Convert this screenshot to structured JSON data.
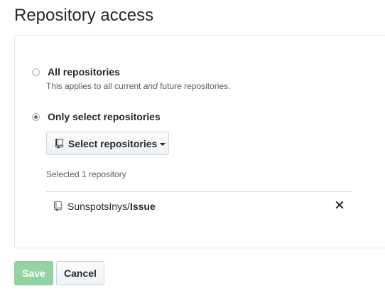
{
  "page": {
    "title": "Repository access"
  },
  "access": {
    "options": [
      {
        "label": "All repositories",
        "checked": false,
        "note_prefix": "This applies to all current ",
        "note_em": "and",
        "note_suffix": " future repositories."
      },
      {
        "label": "Only select repositories",
        "checked": true
      }
    ],
    "select_button_label": "Select repositories",
    "selected_count_text": "Selected 1 repository",
    "repositories": [
      {
        "owner": "SunspotsInys/",
        "name": "Issue"
      }
    ]
  },
  "actions": {
    "save_label": "Save",
    "cancel_label": "Cancel"
  },
  "icons": {
    "repo": "repo-icon",
    "remove": "close-icon",
    "caret": "caret-down-icon"
  },
  "colors": {
    "save_bg": "#94d3a2",
    "text": "#24292e",
    "muted": "#586069"
  }
}
